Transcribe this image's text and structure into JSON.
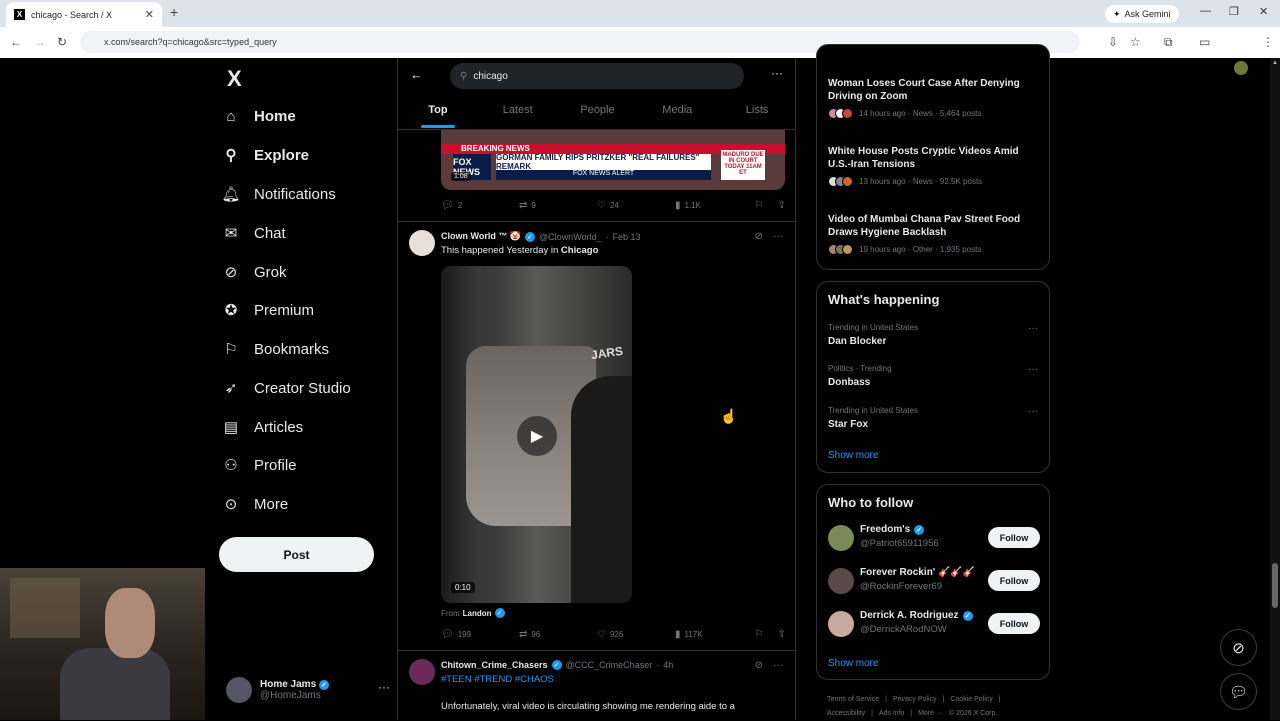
{
  "browser": {
    "tab_title": "chicago - Search / X",
    "new_tab": "+",
    "url": "x.com/search?q=chicago&src=typed_query",
    "ask_gemini": "Ask Gemini"
  },
  "sidebar": {
    "logo": "X",
    "items": [
      {
        "label": "Home",
        "icon": "home-icon"
      },
      {
        "label": "Explore",
        "icon": "search-icon"
      },
      {
        "label": "Notifications",
        "icon": "bell-icon"
      },
      {
        "label": "Chat",
        "icon": "mail-icon"
      },
      {
        "label": "Grok",
        "icon": "grok-icon"
      },
      {
        "label": "Premium",
        "icon": "premium-icon"
      },
      {
        "label": "Bookmarks",
        "icon": "bookmark-icon"
      },
      {
        "label": "Creator Studio",
        "icon": "rocket-icon"
      },
      {
        "label": "Articles",
        "icon": "article-icon"
      },
      {
        "label": "Profile",
        "icon": "person-icon"
      },
      {
        "label": "More",
        "icon": "more-circle-icon"
      }
    ],
    "post_label": "Post",
    "account": {
      "name": "Home Jams",
      "handle": "@HomeJams"
    }
  },
  "search": {
    "query": "chicago",
    "tabs": [
      "Top",
      "Latest",
      "People",
      "Media",
      "Lists"
    ]
  },
  "feed": {
    "fox": {
      "breaking": "BREAKING NEWS",
      "headline": "GORMAN FAMILY RIPS PRITZKER \"REAL FAILURES\" REMARK",
      "alert": "FOX NEWS ALERT",
      "logo": "FOX NEWS",
      "side": "MADURO DUE IN COURT",
      "side2": "TODAY 11AM ET",
      "duration": "1:08",
      "replies": "2",
      "reposts": "9",
      "likes": "24",
      "views": "1.1K"
    },
    "tweet1": {
      "name": "Clown World ™ 🤡",
      "handle": "@ClownWorld_",
      "date": "Feb 13",
      "text_pre": "This happened Yesterday in ",
      "text_bold": "Chicago",
      "video_duration": "0:10",
      "video_sign": "JARS",
      "from_label": "From",
      "from_name": "Landon",
      "replies": "199",
      "reposts": "96",
      "likes": "926",
      "views": "117K"
    },
    "tweet2": {
      "name": "Chitown_Crime_Chasers",
      "handle": "@CCC_CrimeChaser",
      "date": "4h",
      "tags": "#TEEN #TREND #CHAOS",
      "text": "Unfortunately, viral video is circulating showing me rendering aide to a"
    }
  },
  "news": [
    {
      "title": "Woman Loses Court Case After Denying Driving on Zoom",
      "meta": "14 hours ago · News · 5,464 posts"
    },
    {
      "title": "White House Posts Cryptic Videos Amid U.S.-Iran Tensions",
      "meta": "13 hours ago · News · 92.5K posts"
    },
    {
      "title": "Video of Mumbai Chana Pav Street Food Draws Hygiene Backlash",
      "meta": "19 hours ago · Other · 1,935 posts"
    }
  ],
  "happening": {
    "title": "What's happening",
    "trends": [
      {
        "context": "Trending in United States",
        "name": "Dan Blocker"
      },
      {
        "context": "Politics · Trending",
        "name": "Donbass"
      },
      {
        "context": "Trending in United States",
        "name": "Star Fox"
      }
    ],
    "show_more": "Show more"
  },
  "who_to_follow": {
    "title": "Who to follow",
    "users": [
      {
        "name": "Freedom's",
        "handle": "@Patriot65911956",
        "color": "#7a8a5a"
      },
      {
        "name": "Forever Rockin' 🎸🎸🎸",
        "handle": "@RockinForever69",
        "color": "#5a4a4a"
      },
      {
        "name": "Derrick A. Rodriguez",
        "handle": "@DerrickARodNOW",
        "color": "#c9a8a0"
      }
    ],
    "follow_label": "Follow",
    "show_more": "Show more"
  },
  "footer": {
    "links": [
      "Terms of Service",
      "|",
      "Privacy Policy",
      "|",
      "Cookie Policy",
      "|"
    ],
    "links2": [
      "Accessibility",
      "|",
      "Ads info",
      "|",
      "More ···",
      "© 2026 X Corp."
    ]
  },
  "colors": {
    "accent": "#1d9bf0",
    "bg": "#000000",
    "border": "#2f3336"
  }
}
